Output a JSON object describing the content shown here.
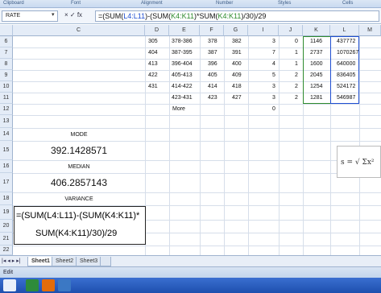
{
  "ribbon": {
    "groups": [
      "Clipboard",
      "Font",
      "Alignment",
      "Number",
      "Styles",
      "Cells"
    ]
  },
  "formula_bar": {
    "name_box": "RATE",
    "buttons": "× ✓ fx",
    "formula": "=(SUM(L4:L11)-(SUM(K4:K11)*SUM(K4:K11)/30)/29"
  },
  "columns": [
    "C",
    "D",
    "E",
    "F",
    "G",
    "I",
    "J",
    "K",
    "L",
    "M"
  ],
  "rows": [
    "6",
    "7",
    "8",
    "9",
    "10",
    "11",
    "12",
    "13",
    "14",
    "15",
    "16",
    "17",
    "18",
    "19",
    "20",
    "21",
    "22"
  ],
  "table_rows": [
    {
      "d": "305",
      "e": "378-386",
      "f": "378",
      "g": "382",
      "i": "3",
      "j": "0",
      "k": "1146",
      "l": "437772"
    },
    {
      "d": "404",
      "e": "387-395",
      "f": "387",
      "g": "391",
      "i": "7",
      "j": "1",
      "k": "2737",
      "l": "1070267"
    },
    {
      "d": "413",
      "e": "396-404",
      "f": "396",
      "g": "400",
      "i": "4",
      "j": "1",
      "k": "1600",
      "l": "640000"
    },
    {
      "d": "422",
      "e": "405-413",
      "f": "405",
      "g": "409",
      "i": "5",
      "j": "2",
      "k": "2045",
      "l": "836405"
    },
    {
      "d": "431",
      "e": "414-422",
      "f": "414",
      "g": "418",
      "i": "3",
      "j": "2",
      "k": "1254",
      "l": "524172"
    },
    {
      "d": "",
      "e": "423-431",
      "f": "423",
      "g": "427",
      "i": "3",
      "j": "2",
      "k": "1281",
      "l": "546987"
    }
  ],
  "more_row": {
    "e": "More",
    "i": "0"
  },
  "stats": {
    "mode_label": "MODE",
    "mode_value": "392.1428571",
    "median_label": "MEDIAN",
    "median_value": "406.2857143",
    "variance_label": "VARIANCE",
    "variance_formula_line1": "=(SUM(L4:L11)-(SUM(K4:K11)*",
    "variance_formula_line2": "SUM(K4:K11)/30)/29"
  },
  "side_formula": "s = √ Σx²",
  "sheet_tabs": [
    "Sheet1",
    "Sheet2",
    "Sheet3"
  ],
  "status": {
    "mode": "Edit"
  },
  "colors": {
    "accent": "#1e4fae",
    "header_bg": "#e4ecf7",
    "ref_blue": "#1f4fd1",
    "ref_green": "#2e8b2e"
  }
}
